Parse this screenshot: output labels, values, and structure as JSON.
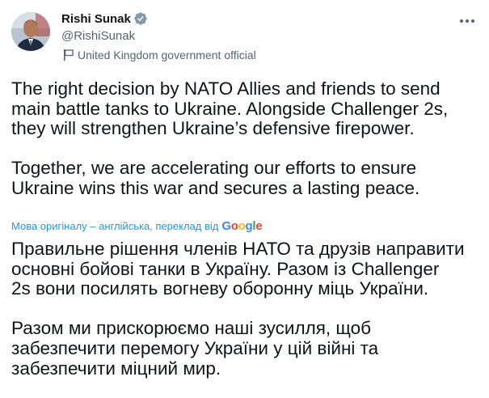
{
  "author": {
    "display_name": "Rishi Sunak",
    "handle": "@RishiSunak",
    "affiliation": "United Kingdom government official",
    "verified_color": "#829aab"
  },
  "icons": {
    "verified": "verified-badge-icon",
    "affiliation": "government-flag-icon",
    "more": "more-options-icon"
  },
  "tweet": {
    "text_en": "The right decision by NATO Allies and friends to send\nmain battle tanks to Ukraine. Alongside Challenger 2s,\nthey will strengthen Ukraine’s defensive firepower.\n\nTogether, we are accelerating our efforts to ensure\nUkraine wins this war and secures a lasting peace.",
    "translation_note": "Мова оригіналу – англійська, переклад від",
    "translation_provider": "Google",
    "text_uk": "Правильне рішення членів НАТО та друзів направити\nосновні бойові танки в Україну. Разом із Challenger\n2s вони посилять вогневу оборонну міць України.\n\nРазом ми прискорюємо наші зусилля, щоб\nзабезпечити перемогу України у цій війні та\nзабезпечити міцний мир."
  },
  "colors": {
    "text": "#0f1419",
    "secondary": "#536471",
    "link": "#1d9bf0"
  }
}
